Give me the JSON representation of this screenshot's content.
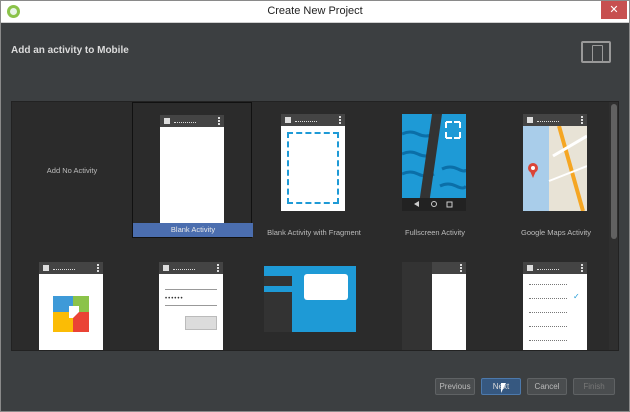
{
  "window": {
    "title": "Create New Project"
  },
  "header": {
    "title": "Add an activity to Mobile"
  },
  "activities": [
    {
      "label": "Add No Activity"
    },
    {
      "label": "Blank Activity"
    },
    {
      "label": "Blank Activity with Fragment"
    },
    {
      "label": "Fullscreen Activity"
    },
    {
      "label": "Google Maps Activity"
    }
  ],
  "login_preview": {
    "placeholder": "••••••"
  },
  "buttons": {
    "previous": "Previous",
    "next": "Next",
    "cancel": "Cancel",
    "finish": "Finish"
  },
  "colors": {
    "selection": "#4b6eaf",
    "accent_blue": "#1e9ad6",
    "background": "#3c3f41"
  }
}
